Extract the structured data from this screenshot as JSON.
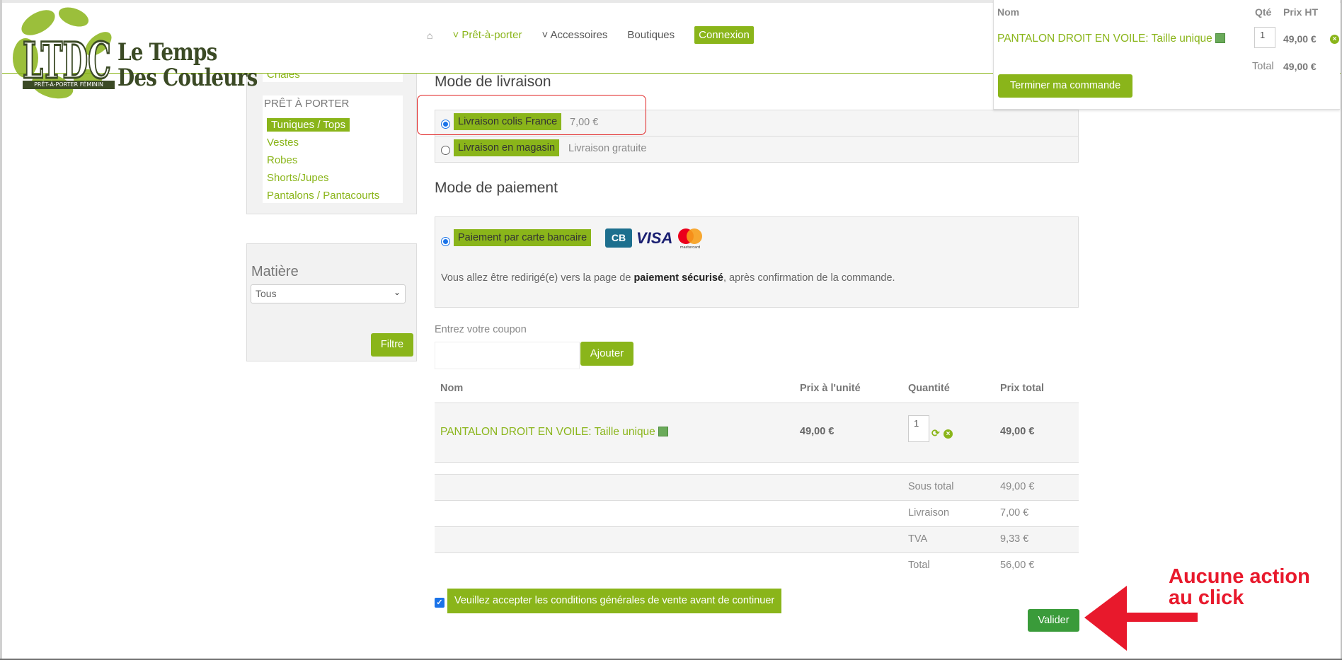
{
  "brand": {
    "logo_mark": "LTDC",
    "line1": "Le Temps",
    "line2": "Des Couleurs",
    "tagline": "PRÊT-À-PORTER FÉMININ",
    "accent_color": "#8ab51a"
  },
  "nav": {
    "home_icon": "home-icon",
    "items": [
      "Prêt-à-porter",
      "Accessoires",
      "Boutiques"
    ],
    "login": "Connexion"
  },
  "mini_cart": {
    "headers": {
      "name": "Nom",
      "qty": "Qté",
      "price": "Prix HT"
    },
    "item": {
      "name": "PANTALON DROIT EN VOILE: Taille unique",
      "qty": "1",
      "price": "49,00 €"
    },
    "total_label": "Total",
    "total_value": "49,00 €",
    "checkout": "Terminer ma commande"
  },
  "sidebar": {
    "partial_item": "Chaies",
    "section_title": "PRÊT À PORTER",
    "links": [
      "Tuniques / Tops",
      "Vestes",
      "Robes",
      "Shorts/Jupes",
      "Pantalons / Pantacourts"
    ],
    "active_index": 0,
    "matiere_title": "Matière",
    "matiere_value": "Tous",
    "filter_btn": "Filtre"
  },
  "shipping": {
    "title": "Mode de livraison",
    "options": [
      {
        "label": "Livraison colis France",
        "price": "7,00 €",
        "selected": true
      },
      {
        "label": "Livraison en magasin",
        "price": "Livraison gratuite",
        "selected": false
      }
    ]
  },
  "payment": {
    "title": "Mode de paiement",
    "option_label": "Paiement par carte bancaire",
    "logos": {
      "cb": "CB",
      "visa": "VISA",
      "mastercard": "mastercard"
    },
    "text_before": "Vous allez être redirigé(e) vers la page de ",
    "text_bold": "paiement sécurisé",
    "text_after": ", après confirmation de la commande."
  },
  "coupon": {
    "label": "Entrez votre coupon",
    "value": "",
    "button": "Ajouter"
  },
  "order_table": {
    "headers": [
      "Nom",
      "Prix à l'unité",
      "Quantité",
      "Prix total"
    ],
    "row": {
      "name": "PANTALON DROIT EN VOILE: Taille unique",
      "unit_price": "49,00 €",
      "qty": "1",
      "total": "49,00 €"
    },
    "summary": [
      {
        "label": "Sous total",
        "value": "49,00 €"
      },
      {
        "label": "Livraison",
        "value": "7,00 €"
      },
      {
        "label": "TVA",
        "value": "9,33 €"
      },
      {
        "label": "Total",
        "value": "56,00 €"
      }
    ]
  },
  "cgv": {
    "label": "Veuillez accepter les conditions générales de vente avant de continuer",
    "checked": true
  },
  "submit": "Valider",
  "annotation": {
    "line1": "Aucune action",
    "line2": "au click",
    "color": "#e8192c"
  }
}
